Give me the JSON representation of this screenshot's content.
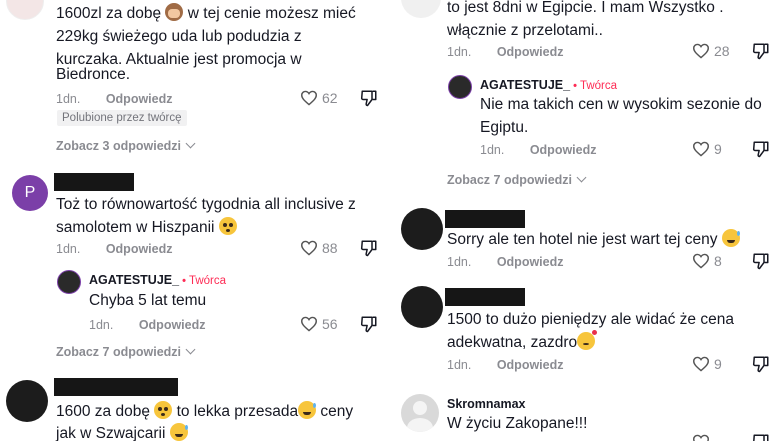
{
  "left": {
    "c1": {
      "text_lines": [
        "1600zl za dobę",
        "w tej cenie możesz mieć",
        "229kg świeżego uda lub podudzia z",
        "kurczaka. Aktualnie jest promocja w",
        "Biedronce."
      ],
      "date": "1dn.",
      "reply": "Odpowiedz",
      "likes": "62",
      "liked_badge": "Polubione przez twórcę",
      "more": "Zobacz 3 odpowiedzi"
    },
    "c2": {
      "avatar_letter": "P",
      "text_lines": [
        "Toż to równowartość tygodnia all inclusive z",
        "samolotem w Hiszpanii"
      ],
      "date": "1dn.",
      "reply": "Odpowiedz",
      "likes": "88"
    },
    "r2": {
      "user": "AGATESTUJE_",
      "creator": "Twórca",
      "text": "Chyba 5 lat temu",
      "date": "1dn.",
      "reply": "Odpowiedz",
      "likes": "56"
    },
    "c2_more": "Zobacz 7 odpowiedzi",
    "c3": {
      "text_lines": [
        "1600 za dobę",
        "to lekka przesada",
        "ceny",
        "jak w Szwajcarii"
      ]
    }
  },
  "right": {
    "c1": {
      "text_lines": [
        "to jest 8dni w Egipcie. I mam Wszystko .",
        "włącznie z przelotami.."
      ],
      "date": "1dn.",
      "reply": "Odpowiedz",
      "likes": "28"
    },
    "r1": {
      "user": "AGATESTUJE_",
      "creator": "Twórca",
      "text_lines": [
        "Nie ma takich cen w wysokim sezonie do",
        "Egiptu."
      ],
      "date": "1dn.",
      "reply": "Odpowiedz",
      "likes": "9"
    },
    "c1_more": "Zobacz 7 odpowiedzi",
    "c2": {
      "text": "Sorry ale ten hotel nie jest wart tej ceny",
      "date": "1dn.",
      "reply": "Odpowiedz",
      "likes": "8"
    },
    "c3": {
      "text_lines": [
        "1500 to dużo pieniędzy ale widać że cena",
        "adekwatna, zazdro"
      ],
      "date": "1dn.",
      "reply": "Odpowiedz",
      "likes": "9"
    },
    "c4": {
      "user": "Skromnamax",
      "text": "W życiu Zakopane!!!"
    }
  },
  "colors": {
    "creator": "#fe2c55",
    "muted": "#8a8b91",
    "text": "#161823",
    "avatar_p": "#7b3fa8"
  }
}
